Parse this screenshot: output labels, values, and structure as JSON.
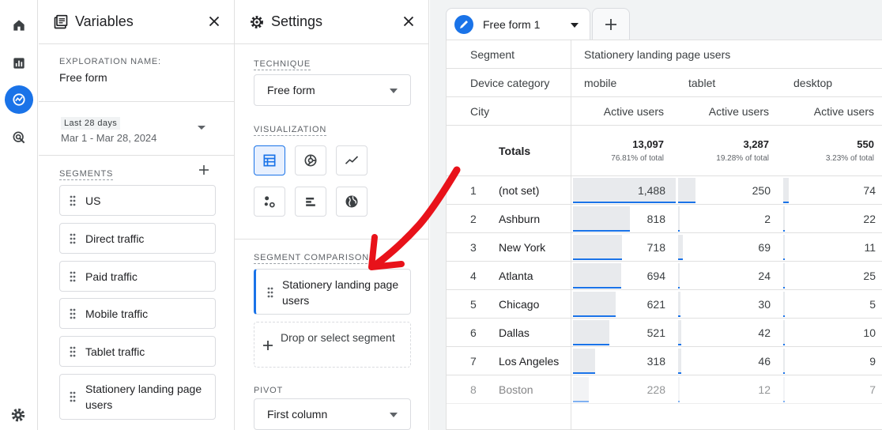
{
  "nav": {
    "icons": [
      "home-icon",
      "bar-chart-icon",
      "explore-icon",
      "advertising-icon",
      "settings-gear-icon"
    ],
    "colors": {
      "active_bg": "#1a73e8"
    }
  },
  "variables": {
    "title": "Variables",
    "exploration_label": "EXPLORATION NAME:",
    "exploration_name": "Free form",
    "date_chip": "Last 28 days",
    "date_range": "Mar 1 - Mar 28, 2024",
    "segments_label": "SEGMENTS",
    "segments": [
      {
        "label": "US"
      },
      {
        "label": "Direct traffic"
      },
      {
        "label": "Paid traffic"
      },
      {
        "label": "Mobile traffic"
      },
      {
        "label": "Tablet traffic"
      },
      {
        "label": "Stationery landing page users"
      }
    ]
  },
  "settings": {
    "title": "Settings",
    "technique_label": "TECHNIQUE",
    "technique_value": "Free form",
    "visualization_label": "VISUALIZATION",
    "visualizations": [
      "table-icon",
      "donut-chart-icon",
      "line-chart-icon",
      "scatter-icon",
      "bar-chart-icon",
      "geo-map-icon"
    ],
    "segment_comparisons_label": "SEGMENT COMPARISONS",
    "comparison_segment": "Stationery landing page users",
    "drop_placeholder": "Drop or select segment",
    "pivot_label": "PIVOT",
    "pivot_value": "First column"
  },
  "tab": {
    "label": "Free form 1",
    "add_label": "+"
  },
  "table": {
    "segment_header": "Segment",
    "segment_value": "Stationery landing page users",
    "device_header": "Device category",
    "devices": [
      "mobile",
      "tablet",
      "desktop"
    ],
    "city_header": "City",
    "metric": "Active users",
    "totals_label": "Totals",
    "totals": [
      {
        "value": "13,097",
        "pct": "76.81% of total"
      },
      {
        "value": "3,287",
        "pct": "19.28% of total"
      },
      {
        "value": "550",
        "pct": "3.23% of total"
      }
    ],
    "rows": [
      {
        "rank": "1",
        "city": "(not set)",
        "mobile": "1,488",
        "tablet": "250",
        "desktop": "74",
        "bars": [
          1.0,
          0.168,
          0.05
        ]
      },
      {
        "rank": "2",
        "city": "Ashburn",
        "mobile": "818",
        "tablet": "2",
        "desktop": "22",
        "bars": [
          0.55,
          0.001,
          0.015
        ]
      },
      {
        "rank": "3",
        "city": "New York",
        "mobile": "718",
        "tablet": "69",
        "desktop": "11",
        "bars": [
          0.48,
          0.046,
          0.007
        ]
      },
      {
        "rank": "4",
        "city": "Atlanta",
        "mobile": "694",
        "tablet": "24",
        "desktop": "25",
        "bars": [
          0.466,
          0.016,
          0.017
        ]
      },
      {
        "rank": "5",
        "city": "Chicago",
        "mobile": "621",
        "tablet": "30",
        "desktop": "5",
        "bars": [
          0.417,
          0.02,
          0.003
        ]
      },
      {
        "rank": "6",
        "city": "Dallas",
        "mobile": "521",
        "tablet": "42",
        "desktop": "10",
        "bars": [
          0.35,
          0.028,
          0.007
        ]
      },
      {
        "rank": "7",
        "city": "Los Angeles",
        "mobile": "318",
        "tablet": "46",
        "desktop": "9",
        "bars": [
          0.214,
          0.031,
          0.006
        ]
      },
      {
        "rank": "8",
        "city": "Boston",
        "mobile": "228",
        "tablet": "12",
        "desktop": "7",
        "bars": [
          0.153,
          0.008,
          0.005
        ]
      }
    ]
  },
  "annotation": {
    "arrow_color": "#e8121a"
  }
}
